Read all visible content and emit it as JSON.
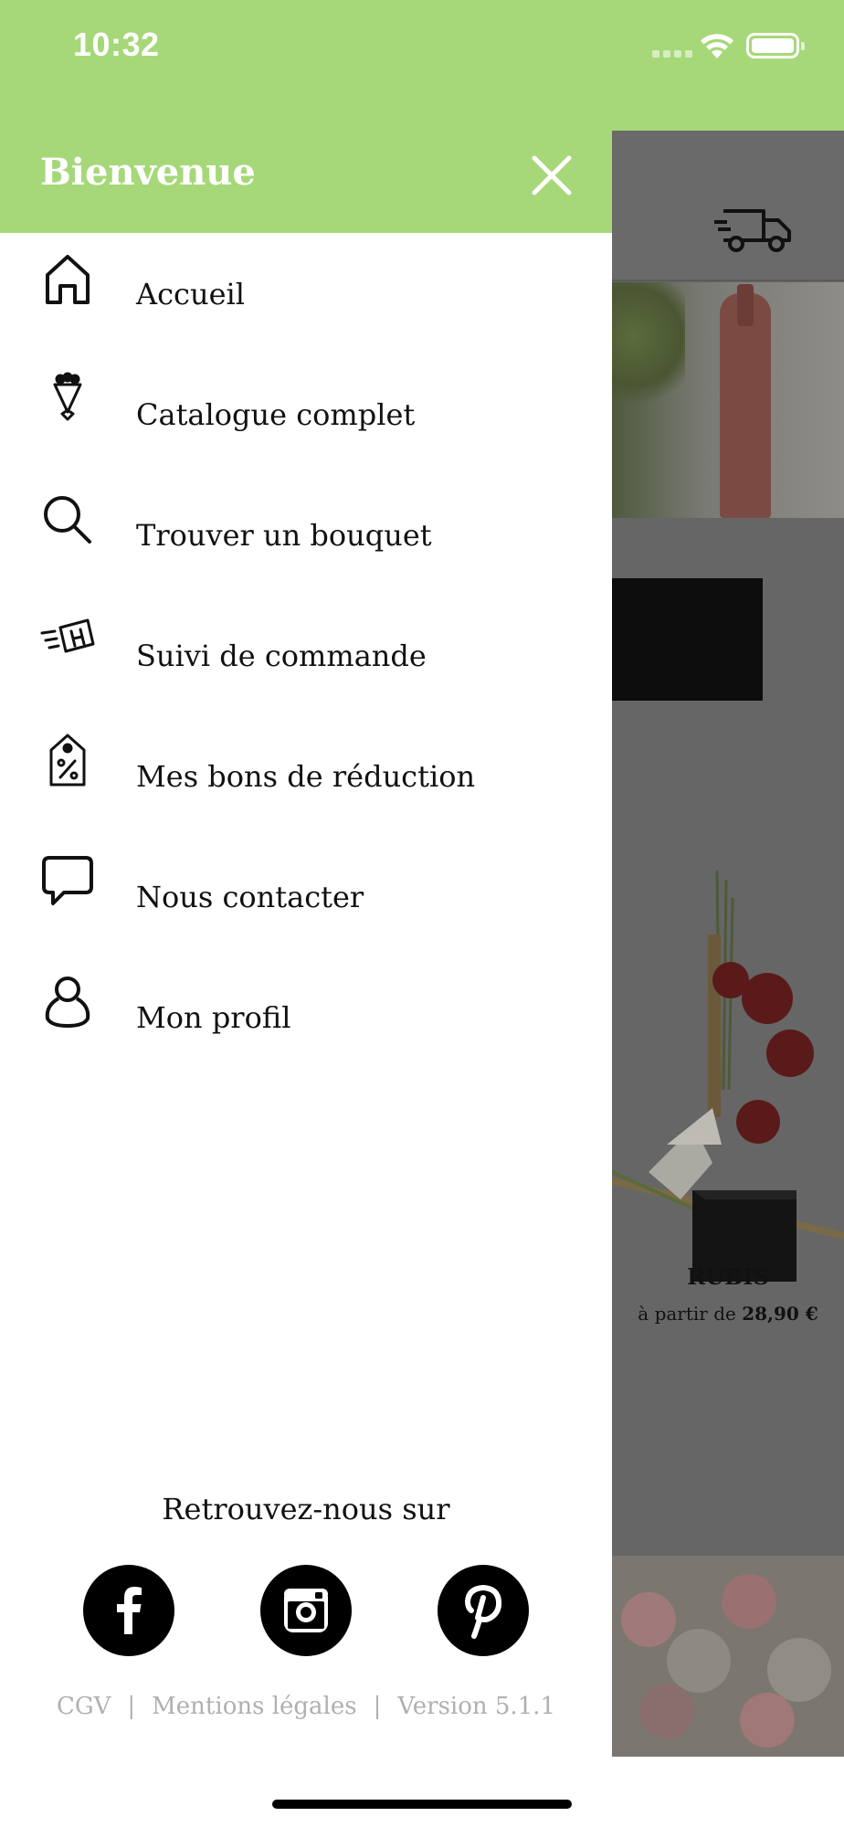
{
  "status_bar": {
    "time": "10:32"
  },
  "drawer": {
    "title": "Bienvenue",
    "menu": [
      {
        "label": "Accueil",
        "icon": "home-icon"
      },
      {
        "label": "Catalogue complet",
        "icon": "bouquet-icon"
      },
      {
        "label": "Trouver un bouquet",
        "icon": "search-icon"
      },
      {
        "label": "Suivi de commande",
        "icon": "delivery-box-icon"
      },
      {
        "label": "Mes bons de réduction",
        "icon": "discount-tag-icon"
      },
      {
        "label": "Nous contacter",
        "icon": "chat-bubble-icon"
      },
      {
        "label": "Mon profil",
        "icon": "user-icon"
      }
    ],
    "follow_label": "Retrouvez-nous sur",
    "social": [
      "facebook-icon",
      "instagram-icon",
      "pinterest-icon"
    ],
    "footer": {
      "cgv": "CGV",
      "legal": "Mentions légales",
      "version": "Version 5.1.1",
      "separator": "|"
    }
  },
  "background_app": {
    "product_name": "RUBIS",
    "price_prefix": "à partir de",
    "price": "28,90 €"
  },
  "colors": {
    "brand_green": "#a6d879",
    "overlay_gray": "#666666",
    "footer_gray": "#b0b0b0"
  }
}
